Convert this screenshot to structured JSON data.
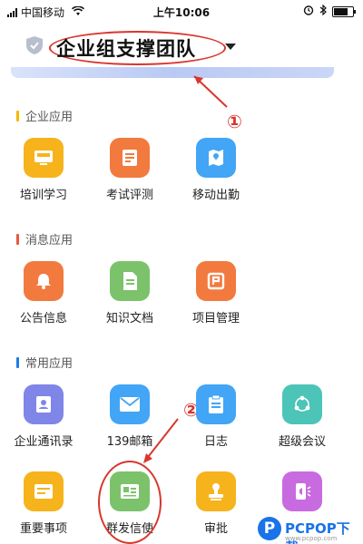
{
  "status_bar": {
    "carrier": "中国移动",
    "time": "上午10:06"
  },
  "header": {
    "team_name": "企业组支撑团队"
  },
  "annotations": {
    "mark_1": "①",
    "mark_2": "②"
  },
  "sections": [
    {
      "title": "企业应用",
      "accent": "#f5b800",
      "apps": [
        {
          "label": "培训学习",
          "icon": "training-icon",
          "color": "#f6b31c"
        },
        {
          "label": "考试评测",
          "icon": "exam-icon",
          "color": "#f27a3e"
        },
        {
          "label": "移动出勤",
          "icon": "attendance-map-icon",
          "color": "#42a5f5"
        }
      ]
    },
    {
      "title": "消息应用",
      "accent": "#e9573f",
      "apps": [
        {
          "label": "公告信息",
          "icon": "bell-icon",
          "color": "#f27a3e"
        },
        {
          "label": "知识文档",
          "icon": "document-icon",
          "color": "#7cc26b"
        },
        {
          "label": "项目管理",
          "icon": "project-icon",
          "color": "#f27a3e"
        }
      ]
    },
    {
      "title": "常用应用",
      "accent": "#1e7ce8",
      "apps": [
        {
          "label": "企业通讯录",
          "icon": "contacts-icon",
          "color": "#7f86e8"
        },
        {
          "label": "139邮箱",
          "icon": "mail-icon",
          "color": "#42a5f5"
        },
        {
          "label": "日志",
          "icon": "log-icon",
          "color": "#42a5f5"
        },
        {
          "label": "超级会议",
          "icon": "meeting-icon",
          "color": "#4cc4b8"
        },
        {
          "label": "重要事项",
          "icon": "important-icon",
          "color": "#f6b31c"
        },
        {
          "label": "群发信使",
          "icon": "broadcast-icon",
          "color": "#7cc26b"
        },
        {
          "label": "审批",
          "icon": "approval-stamp-icon",
          "color": "#f6b31c"
        },
        {
          "label": "",
          "icon": "phone-speaker-icon",
          "color": "#c86be0"
        }
      ]
    }
  ],
  "watermark": {
    "logo_letter": "P",
    "text": "PCPOP下载",
    "sub": "www.pcpop.com"
  }
}
